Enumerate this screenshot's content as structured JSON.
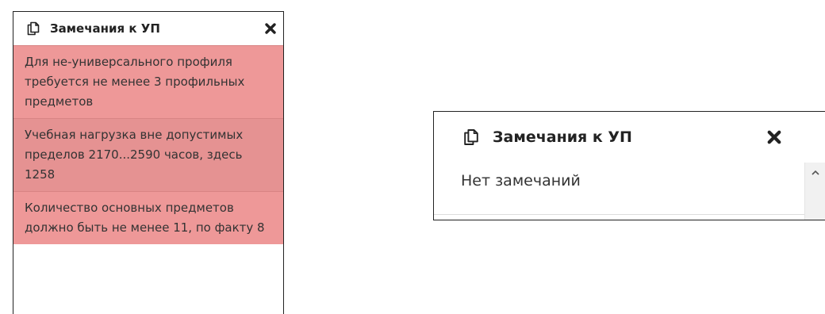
{
  "left_panel": {
    "title": "Замечания к УП",
    "header_icon": "copy-icon",
    "close_icon": "close-icon",
    "messages": [
      "Для не-универсального профиля требуется не менее 3 профильных предметов",
      "Учебная нагрузка вне допустимых пределов 2170...2590 часов, здесь 1258",
      "Количество основных предметов должно быть не менее 11, по факту 8"
    ],
    "message_bg": "#ee9898"
  },
  "right_panel": {
    "title": "Замечания к УП",
    "header_icon": "copy-icon",
    "close_icon": "close-icon",
    "empty_text": "Нет замечаний",
    "scroll_icon": "chevron-up-icon"
  }
}
